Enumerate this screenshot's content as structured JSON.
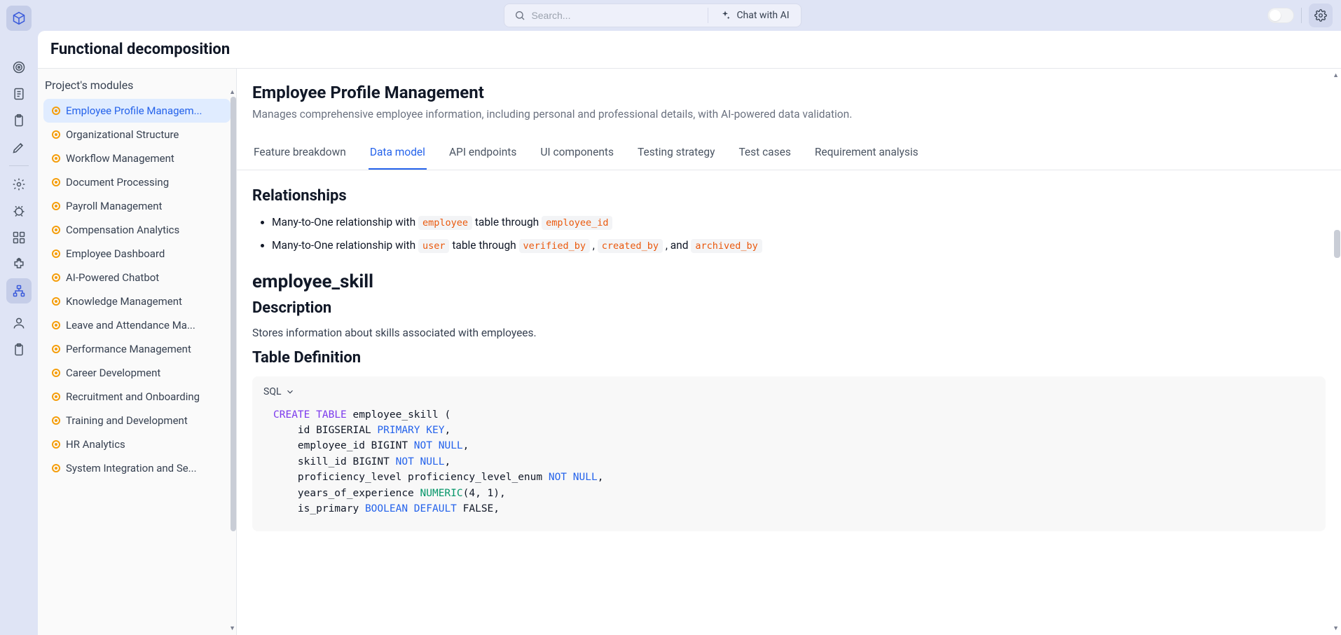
{
  "topbar": {
    "search_placeholder": "Search...",
    "chat_label": "Chat with AI"
  },
  "page": {
    "title": "Functional decomposition"
  },
  "sidebar": {
    "title": "Project's modules",
    "items": [
      {
        "label": "Employee Profile Managem..."
      },
      {
        "label": "Organizational Structure"
      },
      {
        "label": "Workflow Management"
      },
      {
        "label": "Document Processing"
      },
      {
        "label": "Payroll Management"
      },
      {
        "label": "Compensation Analytics"
      },
      {
        "label": "Employee Dashboard"
      },
      {
        "label": "AI-Powered Chatbot"
      },
      {
        "label": "Knowledge Management"
      },
      {
        "label": "Leave and Attendance Ma..."
      },
      {
        "label": "Performance Management"
      },
      {
        "label": "Career Development"
      },
      {
        "label": "Recruitment and Onboarding"
      },
      {
        "label": "Training and Development"
      },
      {
        "label": "HR Analytics"
      },
      {
        "label": "System Integration and Se..."
      }
    ]
  },
  "detail": {
    "title": "Employee Profile Management",
    "description": "Manages comprehensive employee information, including personal and professional details, with AI-powered data validation.",
    "tabs": [
      {
        "label": "Feature breakdown"
      },
      {
        "label": "Data model"
      },
      {
        "label": "API endpoints"
      },
      {
        "label": "UI components"
      },
      {
        "label": "Testing strategy"
      },
      {
        "label": "Test cases"
      },
      {
        "label": "Requirement analysis"
      }
    ],
    "relationships_heading": "Relationships",
    "rel1_pre": "Many-to-One relationship with ",
    "rel1_code": "employee",
    "rel1_mid": " table through ",
    "rel1_code2": "employee_id",
    "rel2_pre": "Many-to-One relationship with ",
    "rel2_code": "user",
    "rel2_mid": " table through ",
    "rel2_code2": "verified_by",
    "rel2_sep": " , ",
    "rel2_code3": "created_by",
    "rel2_sep2": " , and ",
    "rel2_code4": "archived_by",
    "table_name": "employee_skill",
    "desc_heading": "Description",
    "desc_text": "Stores information about skills associated with employees.",
    "tabledef_heading": "Table Definition",
    "code_lang": "SQL"
  }
}
